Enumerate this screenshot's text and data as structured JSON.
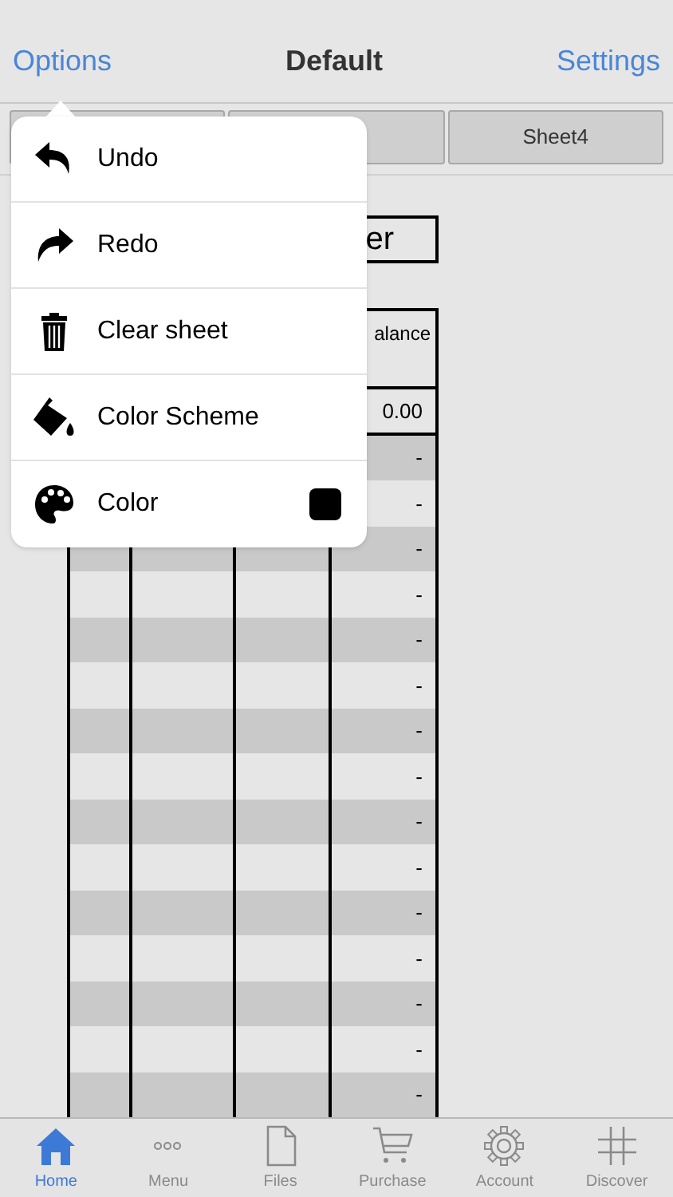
{
  "nav": {
    "left": "Options",
    "title": "Default",
    "right": "Settings"
  },
  "sheet_tabs": [
    {
      "label": "Sheet4"
    }
  ],
  "sheet_title": "er",
  "table": {
    "header": "alance",
    "rows": [
      {
        "balance": "0.00",
        "shaded": false
      },
      {
        "balance": "-",
        "shaded": true
      },
      {
        "balance": "-",
        "shaded": false
      },
      {
        "balance": "-",
        "shaded": true
      },
      {
        "balance": "-",
        "shaded": false
      },
      {
        "balance": "-",
        "shaded": true
      },
      {
        "balance": "-",
        "shaded": false
      },
      {
        "balance": "-",
        "shaded": true
      },
      {
        "balance": "-",
        "shaded": false
      },
      {
        "balance": "-",
        "shaded": true
      },
      {
        "balance": "-",
        "shaded": false
      },
      {
        "balance": "-",
        "shaded": true
      },
      {
        "balance": "-",
        "shaded": false
      },
      {
        "balance": "-",
        "shaded": true
      },
      {
        "balance": "-",
        "shaded": false
      },
      {
        "balance": "-",
        "shaded": true
      }
    ]
  },
  "menu": [
    {
      "kind": "undo",
      "label": "Undo"
    },
    {
      "kind": "redo",
      "label": "Redo"
    },
    {
      "kind": "trash",
      "label": "Clear sheet"
    },
    {
      "kind": "bucket",
      "label": "Color Scheme"
    },
    {
      "kind": "palette",
      "label": "Color",
      "color": "#000000"
    }
  ],
  "tab_bar": [
    {
      "kind": "home",
      "label": "Home",
      "selected": true
    },
    {
      "kind": "dots",
      "label": "Menu",
      "selected": false
    },
    {
      "kind": "file",
      "label": "Files",
      "selected": false
    },
    {
      "kind": "cart",
      "label": "Purchase",
      "selected": false
    },
    {
      "kind": "gear",
      "label": "Account",
      "selected": false
    },
    {
      "kind": "hash",
      "label": "Discover",
      "selected": false
    }
  ]
}
